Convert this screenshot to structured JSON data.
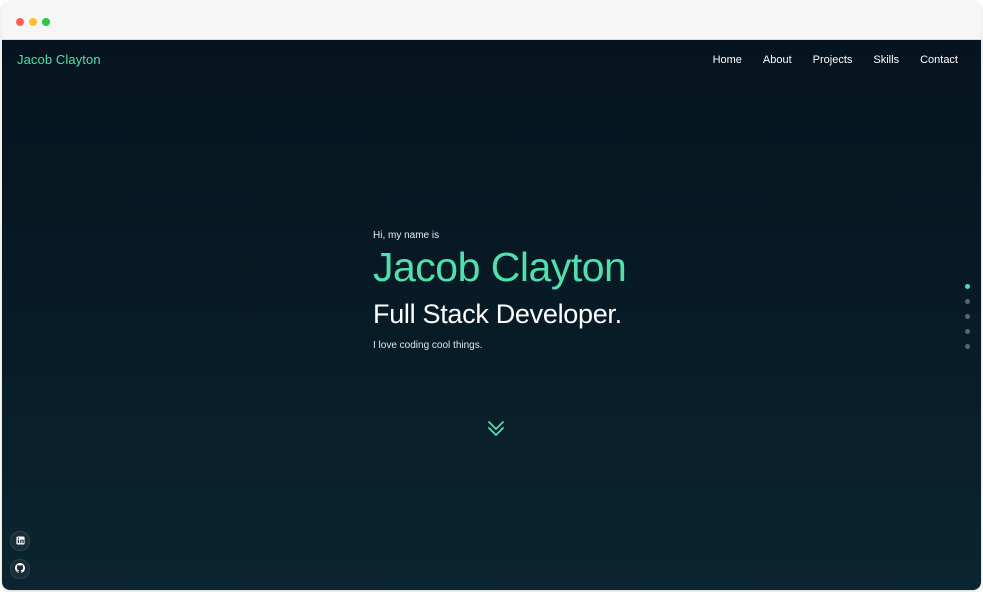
{
  "nav": {
    "brand": "Jacob Clayton",
    "links": [
      "Home",
      "About",
      "Projects",
      "Skills",
      "Contact"
    ]
  },
  "hero": {
    "greeting": "Hi, my name is",
    "name": "Jacob Clayton",
    "role": "Full Stack Developer.",
    "tagline": "I love coding cool things."
  },
  "page_dots": {
    "count": 5,
    "active_index": 0
  },
  "icons": {
    "scroll": "double-chevron-down-icon",
    "social": [
      "linkedin-icon",
      "github-icon"
    ]
  },
  "colors": {
    "accent": "#4fe0ad",
    "background_top": "#06141f",
    "background_bottom": "#0b2530",
    "text": "#ffffff",
    "dot_inactive": "#5a6570"
  }
}
